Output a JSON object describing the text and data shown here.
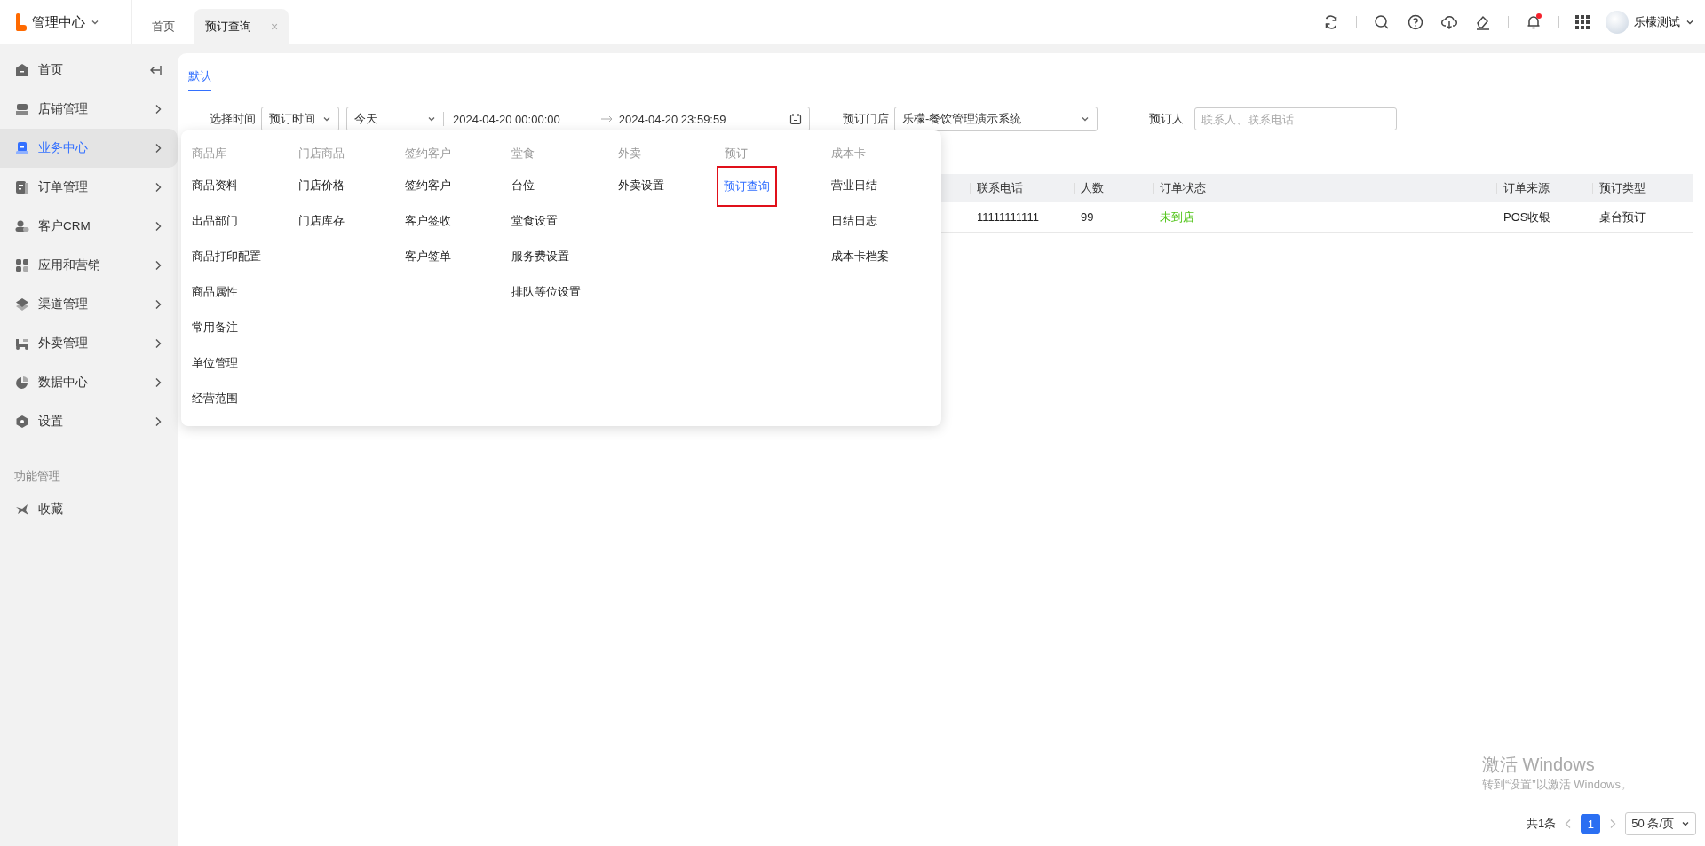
{
  "topbar": {
    "app_menu": "管理中心",
    "tabs": [
      {
        "label": "首页",
        "selected": false,
        "closable": false
      },
      {
        "label": "预订查询",
        "selected": true,
        "closable": true
      }
    ],
    "close_glyph": "×",
    "notification_dot": true,
    "user": "乐檬测试"
  },
  "sidebar": {
    "items": [
      {
        "label": "首页",
        "selected": false,
        "kind": "collapse"
      },
      {
        "label": "店铺管理",
        "selected": false,
        "kind": "chevron"
      },
      {
        "label": "业务中心",
        "selected": true,
        "kind": "chevron"
      },
      {
        "label": "订单管理",
        "selected": false,
        "kind": "chevron"
      },
      {
        "label": "客户CRM",
        "selected": false,
        "kind": "chevron"
      },
      {
        "label": "应用和营销",
        "selected": false,
        "kind": "chevron"
      },
      {
        "label": "渠道管理",
        "selected": false,
        "kind": "chevron"
      },
      {
        "label": "外卖管理",
        "selected": false,
        "kind": "chevron"
      },
      {
        "label": "数据中心",
        "selected": false,
        "kind": "chevron"
      },
      {
        "label": "设置",
        "selected": false,
        "kind": "chevron"
      }
    ],
    "section": "功能管理",
    "favorites": [
      {
        "label": "收藏"
      }
    ]
  },
  "filters": {
    "tabs": [
      {
        "label": "默认",
        "selected": true
      }
    ],
    "time_label": "选择时间",
    "time_type": "预订时间",
    "range_preset": "今天",
    "start": "2024-04-20 00:00:00",
    "end": "2024-04-20 23:59:59",
    "store_label": "预订门店",
    "store": "乐檬-餐饮管理演示系统",
    "person_label": "预订人",
    "person_placeholder": "联系人、联系电话"
  },
  "table": {
    "columns": [
      {
        "label": "联系电话",
        "kind": "text"
      },
      {
        "label": "人数",
        "kind": "text"
      },
      {
        "label": "订单状态",
        "kind": "status"
      },
      {
        "label": "订单来源",
        "kind": "text"
      },
      {
        "label": "预订类型",
        "kind": "text"
      }
    ],
    "rows": [
      {
        "cells": [
          "11111111111",
          "99",
          "未到店",
          "POS收银",
          "桌台预订"
        ]
      }
    ]
  },
  "menu": {
    "groups": [
      {
        "title": "商品库",
        "items": [
          {
            "label": "商品资料",
            "selected": false
          },
          {
            "label": "出品部门",
            "selected": false
          },
          {
            "label": "商品打印配置",
            "selected": false
          },
          {
            "label": "商品属性",
            "selected": false
          },
          {
            "label": "常用备注",
            "selected": false
          },
          {
            "label": "单位管理",
            "selected": false
          },
          {
            "label": "经营范围",
            "selected": false
          }
        ]
      },
      {
        "title": "门店商品",
        "items": [
          {
            "label": "门店价格",
            "selected": false
          },
          {
            "label": "门店库存",
            "selected": false
          }
        ]
      },
      {
        "title": "签约客户",
        "items": [
          {
            "label": "签约客户",
            "selected": false
          },
          {
            "label": "客户签收",
            "selected": false
          },
          {
            "label": "客户签单",
            "selected": false
          }
        ]
      },
      {
        "title": "堂食",
        "items": [
          {
            "label": "台位",
            "selected": false
          },
          {
            "label": "堂食设置",
            "selected": false
          },
          {
            "label": "服务费设置",
            "selected": false
          },
          {
            "label": "排队等位设置",
            "selected": false
          }
        ]
      },
      {
        "title": "外卖",
        "items": [
          {
            "label": "外卖设置",
            "selected": false
          }
        ]
      },
      {
        "title": "预订",
        "items": [
          {
            "label": "预订查询",
            "selected": true
          }
        ]
      },
      {
        "title": "成本卡",
        "items": [
          {
            "label": "营业日结",
            "selected": false
          },
          {
            "label": "日结日志",
            "selected": false
          },
          {
            "label": "成本卡档案",
            "selected": false
          }
        ]
      }
    ]
  },
  "pager": {
    "total": "共1条",
    "pages": [
      {
        "label": "1",
        "selected": true
      }
    ],
    "page_size": "50 条/页"
  },
  "os_notice": {
    "title": "激活 Windows",
    "subtitle": "转到“设置”以激活 Windows。"
  }
}
